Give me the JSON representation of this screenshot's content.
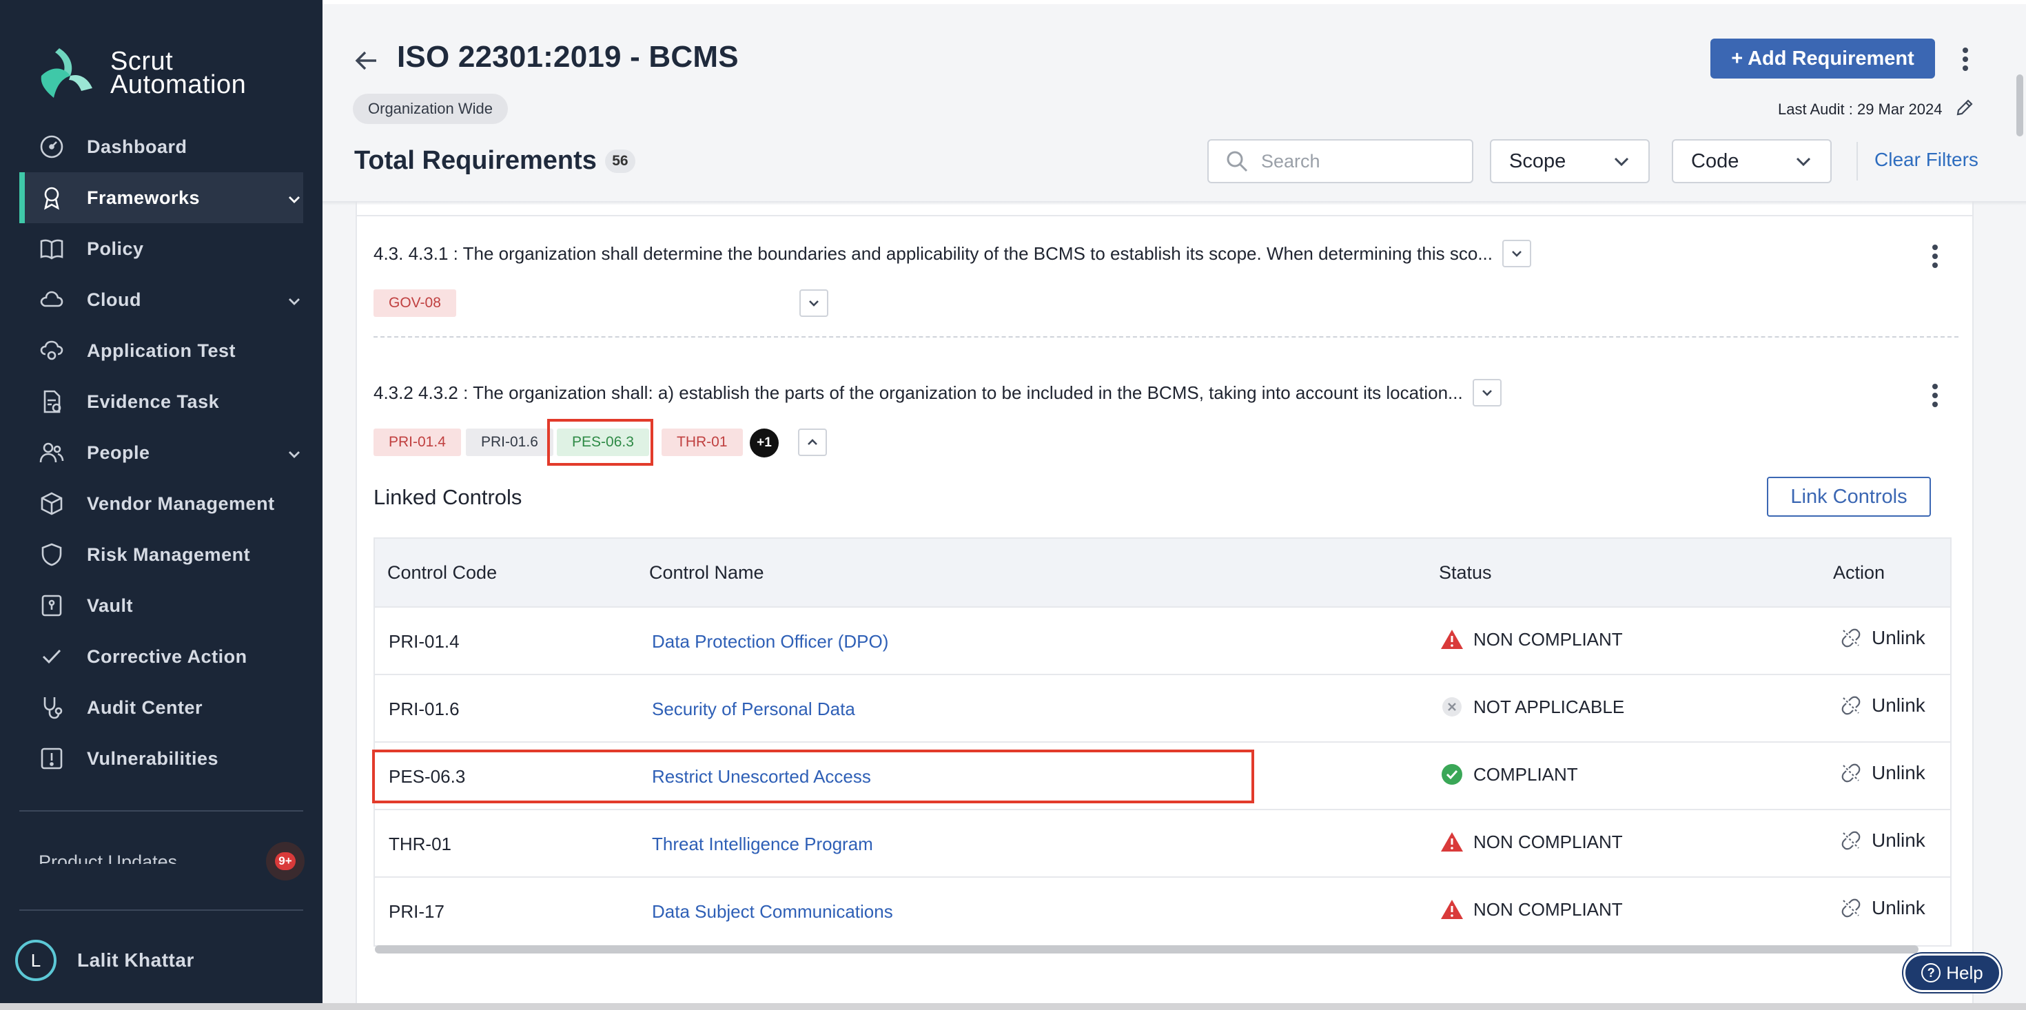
{
  "brand": {
    "line1": "Scrut",
    "line2": "Automation",
    "accent": "#3fc8a8"
  },
  "sidebar": {
    "items": [
      {
        "label": "Dashboard",
        "icon": "dashboard-gauge-icon"
      },
      {
        "label": "Frameworks",
        "icon": "award-ribbon-icon",
        "active": true
      },
      {
        "label": "Policy",
        "icon": "book-icon"
      },
      {
        "label": "Cloud",
        "icon": "cloud-icon"
      },
      {
        "label": "Application Test",
        "icon": "cloud-gear-icon"
      },
      {
        "label": "Evidence Task",
        "icon": "document-check-icon"
      },
      {
        "label": "People",
        "icon": "people-icon"
      },
      {
        "label": "Vendor Management",
        "icon": "box-icon"
      },
      {
        "label": "Risk Management",
        "icon": "shield-icon"
      },
      {
        "label": "Vault",
        "icon": "vault-icon"
      },
      {
        "label": "Corrective Action",
        "icon": "check-icon"
      },
      {
        "label": "Audit Center",
        "icon": "stethoscope-icon"
      },
      {
        "label": "Vulnerabilities",
        "icon": "alert-square-icon"
      }
    ],
    "product_updates": "Product Updates",
    "notif_count": "9+",
    "user": {
      "initial": "L",
      "name": "Lalit Khattar"
    }
  },
  "header": {
    "title": "ISO 22301:2019 - BCMS",
    "scope_chip": "Organization Wide",
    "add_button": "+ Add Requirement",
    "last_audit": "Last Audit : 29 Mar 2024"
  },
  "filters": {
    "total_label": "Total Requirements",
    "total_count": "56",
    "search_placeholder": "Search",
    "scope_label": "Scope",
    "code_label": "Code",
    "clear_label": "Clear Filters"
  },
  "requirements": [
    {
      "text": "4.3. 4.3.1 : The organization shall determine the boundaries and applicability of the BCMS to establish its scope. When determining this sco...",
      "tags": [
        "GOV-08"
      ]
    },
    {
      "text": "4.3.2 4.3.2 : The organization shall: a) establish the parts of the organization to be included in the BCMS, taking into account its location...",
      "tags": [
        "PRI-01.4",
        "PRI-01.6",
        "PES-06.3",
        "THR-01"
      ],
      "more": "+1"
    }
  ],
  "linked_controls": {
    "title": "Linked Controls",
    "link_button": "Link Controls",
    "columns": [
      "Control Code",
      "Control Name",
      "Status",
      "Action"
    ],
    "rows": [
      {
        "code": "PRI-01.4",
        "name": "Data Protection Officer (DPO)",
        "status": "NON COMPLIANT",
        "action": "Unlink"
      },
      {
        "code": "PRI-01.6",
        "name": "Security of Personal Data",
        "status": "NOT APPLICABLE",
        "action": "Unlink"
      },
      {
        "code": "PES-06.3",
        "name": "Restrict Unescorted Access",
        "status": "COMPLIANT",
        "action": "Unlink"
      },
      {
        "code": "THR-01",
        "name": "Threat Intelligence Program",
        "status": "NON COMPLIANT",
        "action": "Unlink"
      },
      {
        "code": "PRI-17",
        "name": "Data Subject Communications",
        "status": "NON COMPLIANT",
        "action": "Unlink"
      }
    ]
  },
  "help_label": "Help",
  "colors": {
    "primary": "#3b67b3",
    "danger": "#d93a3a",
    "success": "#3aa757",
    "highlight": "#e23b2b",
    "sidebar_bg": "#1b2637"
  }
}
